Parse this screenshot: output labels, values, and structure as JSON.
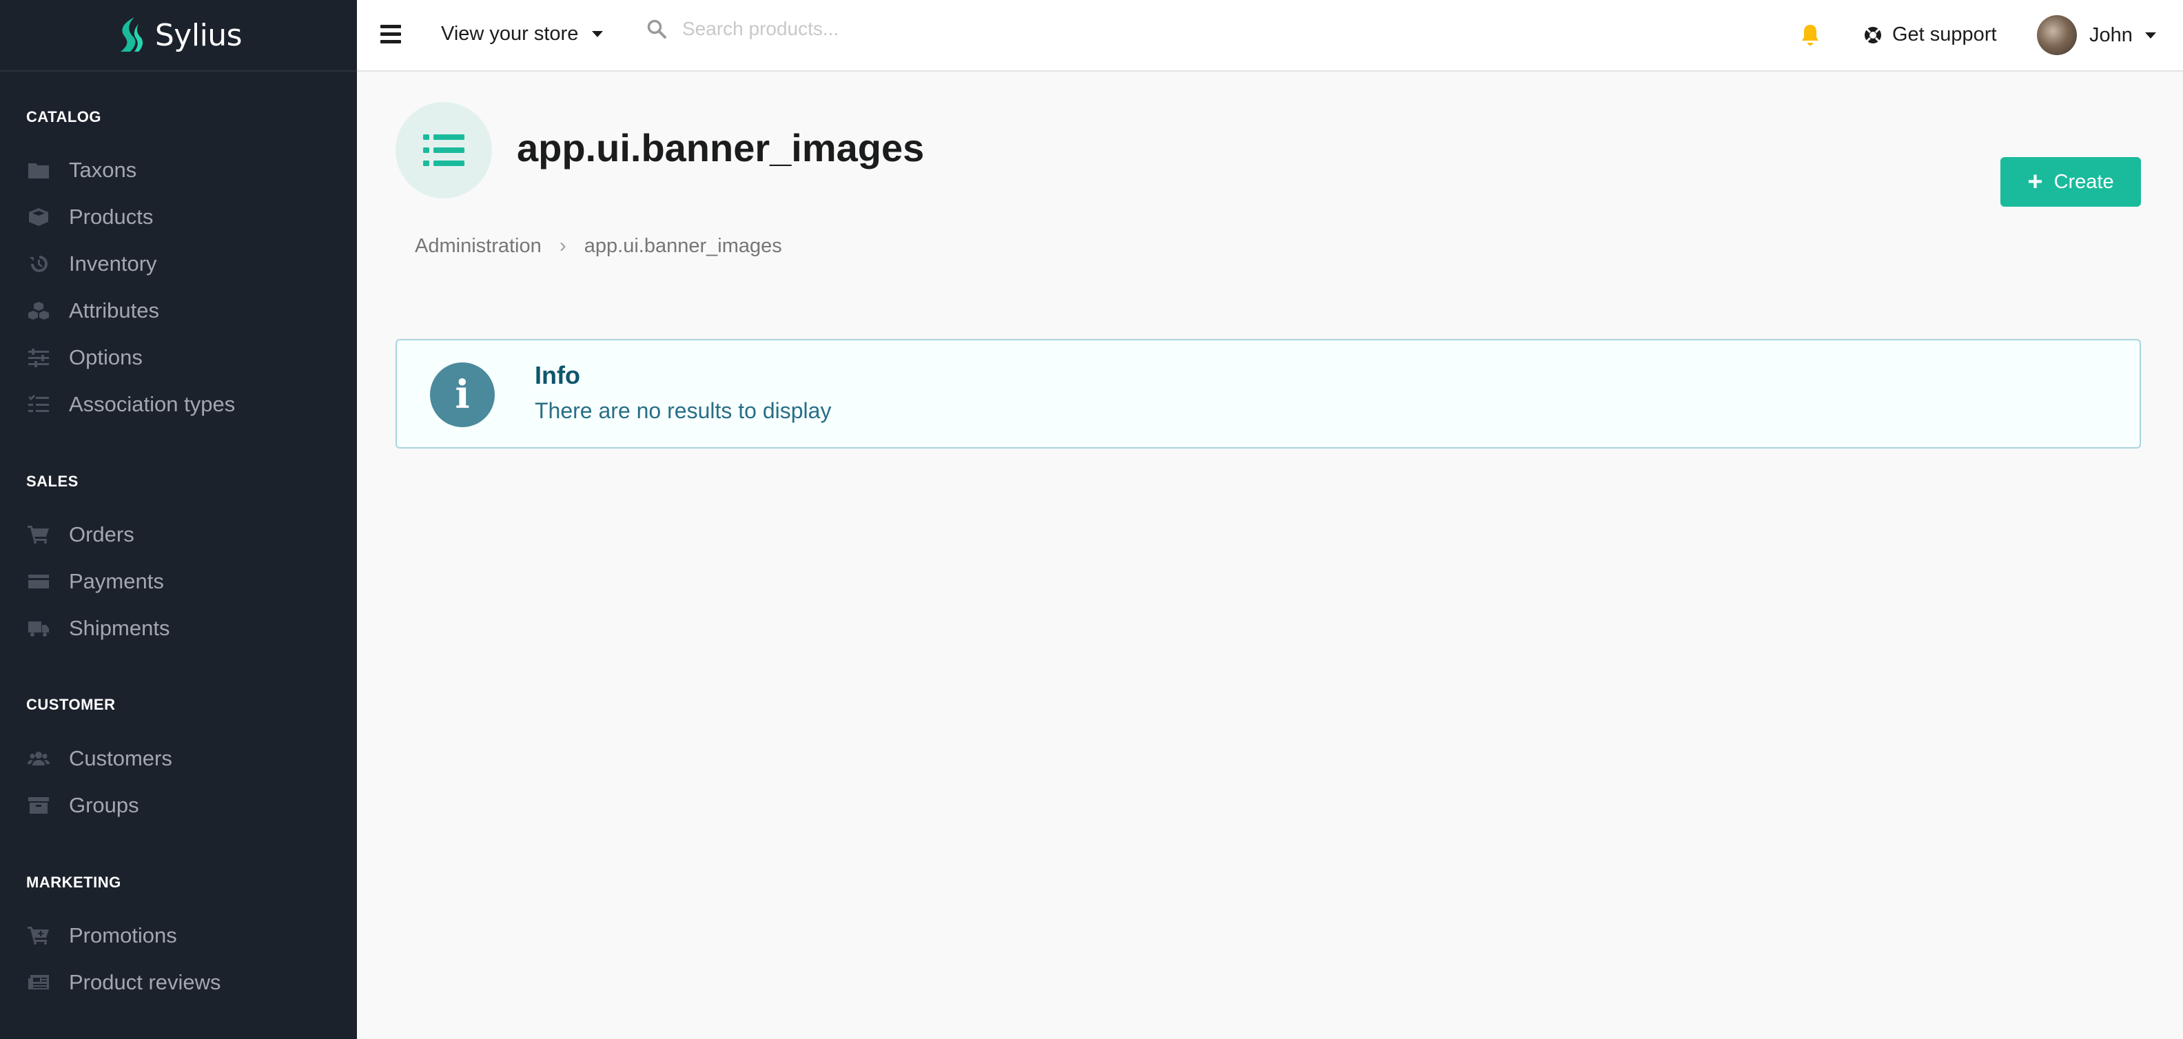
{
  "brand": {
    "name": "Sylius",
    "accent": "#1abb9c"
  },
  "sidebar": {
    "sections": [
      {
        "title": "CATALOG",
        "items": [
          {
            "label": "Taxons",
            "icon": "folder-icon"
          },
          {
            "label": "Products",
            "icon": "cube-icon"
          },
          {
            "label": "Inventory",
            "icon": "history-icon"
          },
          {
            "label": "Attributes",
            "icon": "cubes-icon"
          },
          {
            "label": "Options",
            "icon": "sliders-icon"
          },
          {
            "label": "Association types",
            "icon": "tasks-icon"
          }
        ]
      },
      {
        "title": "SALES",
        "items": [
          {
            "label": "Orders",
            "icon": "cart-icon"
          },
          {
            "label": "Payments",
            "icon": "credit-card-icon"
          },
          {
            "label": "Shipments",
            "icon": "truck-icon"
          }
        ]
      },
      {
        "title": "CUSTOMER",
        "items": [
          {
            "label": "Customers",
            "icon": "users-icon"
          },
          {
            "label": "Groups",
            "icon": "archive-icon"
          }
        ]
      },
      {
        "title": "MARKETING",
        "items": [
          {
            "label": "Promotions",
            "icon": "cart-plus-icon"
          },
          {
            "label": "Product reviews",
            "icon": "newspaper-icon"
          }
        ]
      }
    ]
  },
  "topbar": {
    "store_link": "View your store",
    "search_placeholder": "Search products...",
    "support": "Get support",
    "user": "John"
  },
  "page": {
    "title": "app.ui.banner_images",
    "create_label": "Create",
    "breadcrumb": [
      "Administration",
      "app.ui.banner_images"
    ]
  },
  "info": {
    "title": "Info",
    "message": "There are no results to display"
  }
}
